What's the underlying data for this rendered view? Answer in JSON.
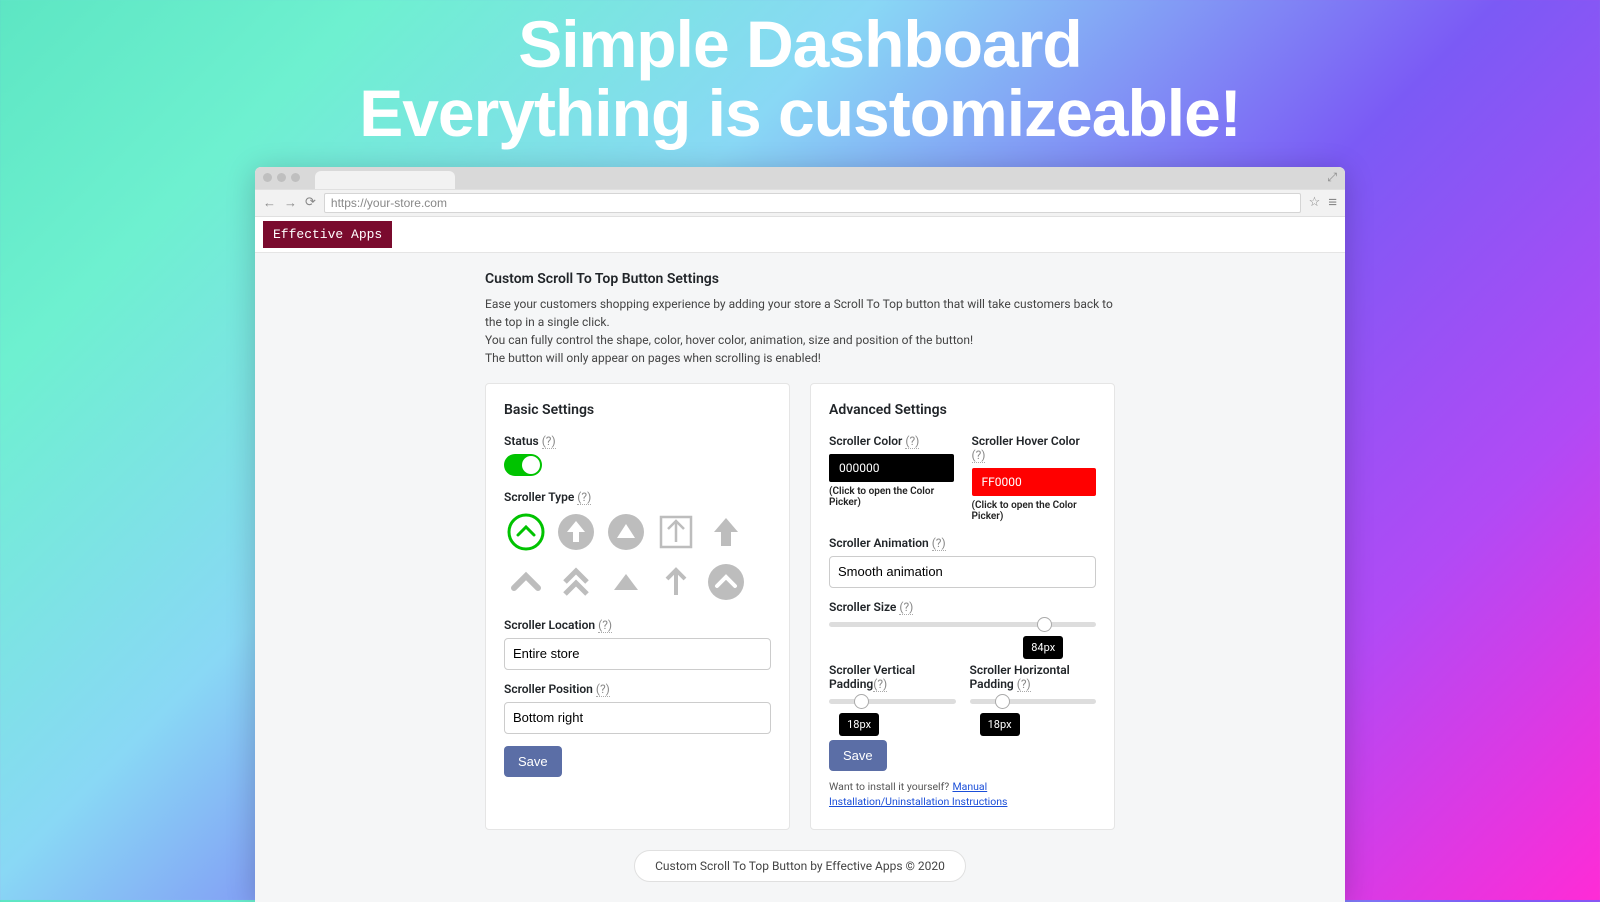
{
  "hero": {
    "line1": "Simple Dashboard",
    "line2": "Everything is customizeable!"
  },
  "browser": {
    "url": "https://your-store.com"
  },
  "app": {
    "name": "Effective Apps"
  },
  "settings": {
    "title": "Custom Scroll To Top Button Settings",
    "description1": "Ease your customers shopping experience by adding your store a Scroll To Top button that will take customers back to the top in a single click.",
    "description2": "You can fully control the shape, color, hover color, animation, size and position of the button!",
    "description3": "The button will only appear on pages when scrolling is enabled!"
  },
  "basic": {
    "heading": "Basic Settings",
    "status_label": "Status",
    "status_on": true,
    "scroller_type_label": "Scroller Type",
    "scroller_types": [
      {
        "name": "circle-chevron-outline",
        "selected": true
      },
      {
        "name": "circle-arrow-solid"
      },
      {
        "name": "circle-triangle-solid"
      },
      {
        "name": "square-arrow-outline"
      },
      {
        "name": "arrow-solid"
      },
      {
        "name": "chevron-single"
      },
      {
        "name": "chevron-double"
      },
      {
        "name": "triangle-solid"
      },
      {
        "name": "arrow-thin"
      },
      {
        "name": "circle-chevron-solid"
      }
    ],
    "location_label": "Scroller Location",
    "location_value": "Entire store",
    "position_label": "Scroller Position",
    "position_value": "Bottom right",
    "save_label": "Save"
  },
  "advanced": {
    "heading": "Advanced Settings",
    "color_label": "Scroller Color",
    "color_value": "000000",
    "hover_color_label": "Scroller Hover Color",
    "hover_color_value": "FF0000",
    "color_swatch_hex": "#000000",
    "hover_swatch_hex": "#ff0000",
    "color_picker_hint": "(Click to open the Color Picker)",
    "animation_label": "Scroller Animation",
    "animation_value": "Smooth animation",
    "size_label": "Scroller Size",
    "size_value": "84px",
    "size_percent": 78,
    "vpad_label": "Scroller Vertical Padding",
    "vpad_value": "18px",
    "vpad_percent": 20,
    "hpad_label": "Scroller Horizontal Padding",
    "hpad_value": "18px",
    "hpad_percent": 20,
    "save_label": "Save",
    "install_q": "Want to install it yourself?",
    "install_link": "Manual Installation/Uninstallation Instructions"
  },
  "help_marker": "(?)",
  "footer": "Custom Scroll To Top Button by Effective Apps © 2020"
}
